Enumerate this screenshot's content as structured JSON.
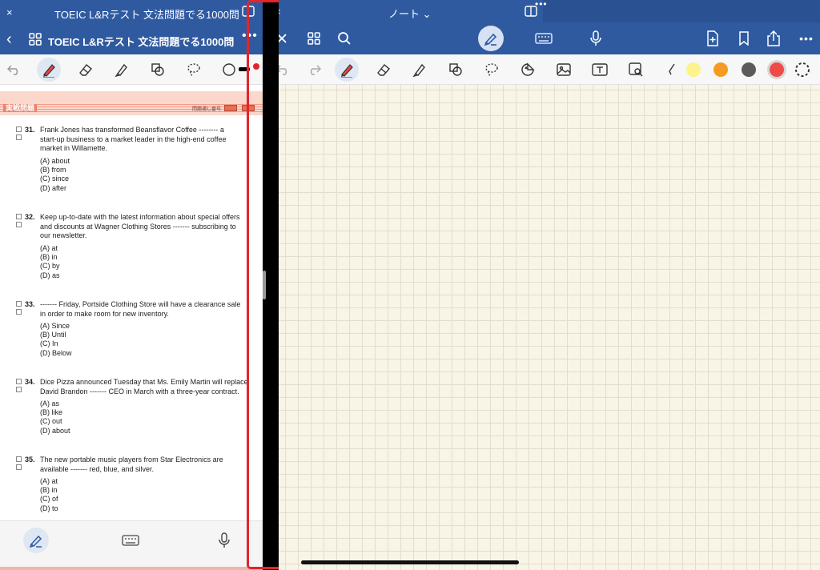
{
  "left_pane": {
    "window_title": "TOEIC L&Rテスト 文法問題でる1000問",
    "close_glyph": "×",
    "nav": {
      "back_glyph": "‹",
      "doc_title": "TOEIC L&Rテスト 文法問題でる1000問",
      "chevron_glyph": "⌄",
      "more_glyph": "•••"
    },
    "page_header": {
      "section_label": "実戦問題",
      "meta_text": "問題通し番号"
    },
    "questions": [
      {
        "number": "31.",
        "stem": [
          "Frank Jones has transformed Beansflavor Coffee -------- a",
          "start-up business to a market leader in the high-end coffee",
          "market in Willamette."
        ],
        "options": [
          "(A) about",
          "(B) from",
          "(C) since",
          "(D) after"
        ]
      },
      {
        "number": "32.",
        "stem": [
          "Keep up-to-date with the latest information about special offers",
          "and discounts at Wagner Clothing Stores ------- subscribing to",
          "our newsletter."
        ],
        "options": [
          "(A) at",
          "(B) in",
          "(C) by",
          "(D) as"
        ]
      },
      {
        "number": "33.",
        "stem": [
          "------- Friday, Portside Clothing Store will have a clearance sale",
          "in order to make room for new inventory."
        ],
        "options": [
          "(A) Since",
          "(B) Until",
          "(C) In",
          "(D) Below"
        ]
      },
      {
        "number": "34.",
        "stem": [
          "Dice Pizza announced Tuesday that Ms. Emily Martin will replace",
          "David Brandon ------- CEO in March with a three-year contract."
        ],
        "options": [
          "(A) as",
          "(B) like",
          "(C) out",
          "(D) about"
        ]
      },
      {
        "number": "35.",
        "stem": [
          "The new portable music players from Star Electronics are",
          "available ------- red, blue, and silver."
        ],
        "options": [
          "(A) at",
          "(B) in",
          "(C) of",
          "(D) to"
        ]
      }
    ]
  },
  "right_pane": {
    "close_glyph": "×",
    "window_title": "ノート ⌄",
    "more_glyph": "•••",
    "dots_glyph": "•••"
  },
  "colors": {
    "brand_blue": "#2f5aa0",
    "highlight_red": "#e3242b",
    "swatch_yellow": "#fdf38a",
    "swatch_orange": "#f59a23",
    "swatch_gray": "#5b5b5b",
    "swatch_red": "#ef4a4a",
    "paper": "#f8f4e6"
  },
  "icons": {
    "left_titlebar": "split-view-icon",
    "left_nav": [
      "back-icon",
      "grid-icon",
      "chevron-down-icon",
      "more-icon"
    ],
    "left_toolbar": [
      "undo-icon",
      "pen-icon",
      "eraser-icon",
      "highlighter-icon",
      "shapes-icon",
      "lasso-icon",
      "more-tools-icon"
    ],
    "left_bottom": [
      "pen-mode-icon",
      "keyboard-icon",
      "microphone-icon"
    ],
    "right_nav": [
      "close-icon",
      "grid-icon",
      "search-icon",
      "pen-mode-icon",
      "keyboard-icon",
      "microphone-icon",
      "add-page-icon",
      "bookmark-icon",
      "share-icon",
      "more-icon"
    ],
    "right_toolbar": [
      "undo-icon",
      "redo-icon",
      "pen-icon",
      "eraser-icon",
      "highlighter-icon",
      "shapes-icon",
      "lasso-icon",
      "sticker-icon",
      "image-icon",
      "text-icon",
      "image-search-icon",
      "laser-pointer-icon"
    ]
  }
}
